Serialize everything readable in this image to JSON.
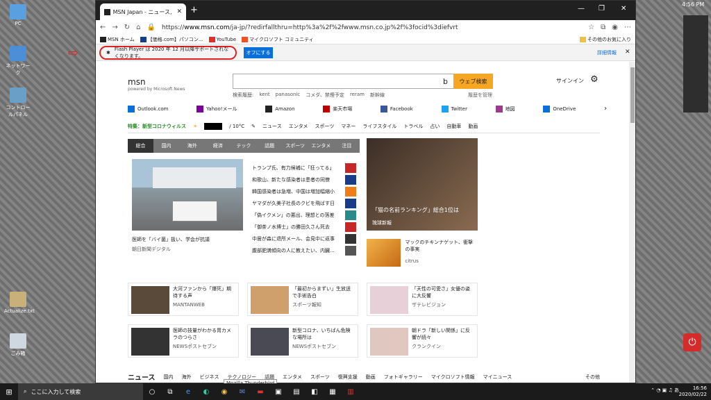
{
  "tab_title": "MSN Japan - ニュース, 天気, メール",
  "url_prefix": "https://",
  "url_host": "www.msn.com",
  "url_rest": "/ja-jp/?redirfallthru=http%3a%2f%2fwww.msn.co.jp%2f%3focid%3diefvrt",
  "bookmarks": [
    "MSN ホーム",
    "【価格.com】パソコン...",
    "YouTube",
    "マイクロソフト コミュニティ"
  ],
  "bookmarks_right": "その他のお気に入り",
  "flash_text": "Flash Player は 2020 年 12 月以降サポートされなくなります。",
  "flash_button": "オフにする",
  "flash_more": "詳細情報",
  "logo": "msn",
  "logo_sub": "powered by Microsoft News",
  "search_button": "ウェブ検索",
  "history": [
    "検索履歴:",
    "kent",
    "panasonic",
    "コメダ、禁煙予定",
    "reram",
    "新幹線"
  ],
  "history_manage": "履歴を管理",
  "signin": "サインイン",
  "quick_links": [
    "Outlook.com",
    "Yahoo!メール",
    "Amazon",
    "楽天市場",
    "Facebook",
    "Twitter",
    "地図",
    "OneDrive"
  ],
  "quick_colors": [
    "#0a6fd8",
    "#7b0099",
    "#222222",
    "#bf0000",
    "#3b5998",
    "#1da1f2",
    "#9b3b8a",
    "#0a6fd8"
  ],
  "strip_special": "特集：新型コロナウィルス",
  "strip_temp": "/ 10°C",
  "strip_items": [
    "ニュース",
    "エンタメ",
    "スポーツ",
    "マネー",
    "ライフスタイル",
    "トラベル",
    "占い",
    "自動車",
    "動画"
  ],
  "categories": [
    "総合",
    "国内",
    "海外",
    "経済",
    "テック",
    "話題",
    "スポーツ",
    "エンタメ",
    "注目"
  ],
  "hero_title": "医師を「バイ菌」扱い、学会が抗議",
  "hero_source": "朝日新聞デジタル",
  "headlines": [
    "トランプ氏、有力候補に「狂ってる」",
    "和歌山、新たな感染者は患者の同僚",
    "韓国感染者は急増、中国は増加幅縮小",
    "ヤマダが久美子社長のクビを飛ばす日",
    "「偽イクメン」の悪出、理想との落差",
    "「御茶ノ水博士」の勝田久さん死去",
    "中居が森に退所メール、会見中に返事",
    "腹部肥満傾向の人に教えたい、内臓..."
  ],
  "headline_colors": [
    "#c62828",
    "#1a3a8a",
    "#f07c1a",
    "#1a3a8a",
    "#2a8a8a",
    "#c62828",
    "#333333",
    "#555555"
  ],
  "feature_caption": "「猫の名前ランキング」総合1位は",
  "feature_source": "琉球新報",
  "mini_title": "マックのチキンナゲット、衝撃の事実",
  "mini_source": "citrus",
  "cards": [
    {
      "title": "大河ファンから「爆死」期待する声",
      "source": "MANTANWEB",
      "color": "#5a4a3a"
    },
    {
      "title": "「最初からまずい」生放送で手術告白",
      "source": "スポーツ報知",
      "color": "#cfa06b"
    },
    {
      "title": "「天性の可愛さ」女優の姿に大反響",
      "source": "ザテレビジョン",
      "color": "#e8d0d8"
    },
    {
      "title": "医師の技量がわかる胃カメラのつらさ",
      "source": "NEWSポストセブン",
      "color": "#333333"
    },
    {
      "title": "新型コロナ、いちばん危険な場所は",
      "source": "NEWSポストセブン",
      "color": "#4a4a55"
    },
    {
      "title": "朝ドラ「新しい関係」に反響が続々",
      "source": "クランクイン",
      "color": "#e0c8c0"
    }
  ],
  "bottom_nav_title": "ニュース",
  "bottom_nav": [
    "国内",
    "海外",
    "ビジネス",
    "テクノロジー",
    "話題",
    "エンタメ",
    "スポーツ",
    "復興支援",
    "動画",
    "フォトギャラリー",
    "マイクロソフト情報",
    "マイニュース"
  ],
  "bottom_more": "その他",
  "taskbar_search": "ここに入力して検索",
  "tooltip": "Mozilla Thunderbird",
  "clock_time": "16:56",
  "clock_date": "2020/02/22",
  "desktop_time": "4:56 PM",
  "desktop_icons": [
    "PC",
    "ネットワーク",
    "コントロールパネル",
    "Actualize.txt",
    "ごみ箱"
  ]
}
